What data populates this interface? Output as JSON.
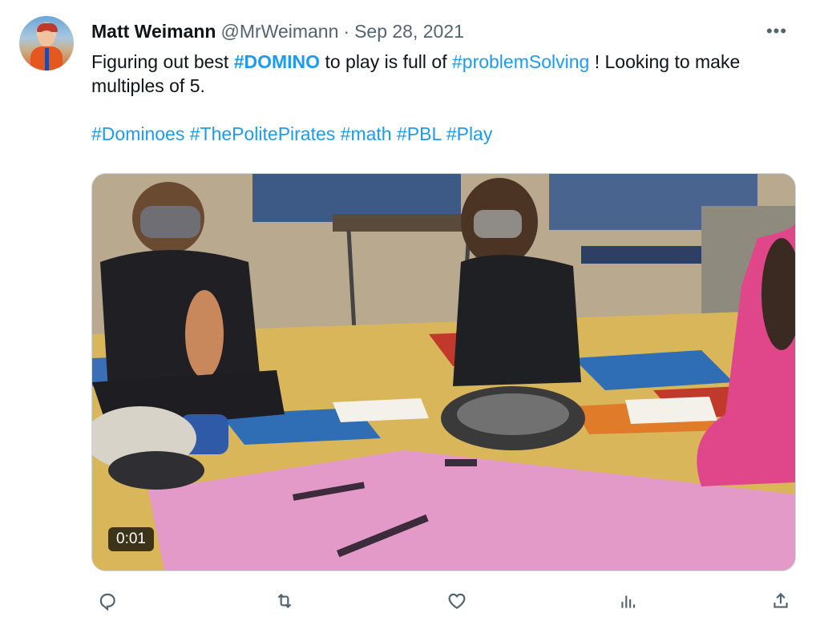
{
  "tweet": {
    "author_name": "Matt Weimann",
    "handle": "@MrWeimann",
    "separator": "·",
    "date": "Sep 28, 2021",
    "more_label": "•••",
    "text": {
      "part1": "Figuring out best ",
      "tag1": "#DOMINO",
      "part2": " to play is full of ",
      "tag2": "#problemSolving",
      "part3": " ! Looking to make multiples of 5.",
      "tags": [
        "#Dominoes",
        "#ThePolitePirates",
        "#math",
        "#PBL",
        "#Play"
      ]
    },
    "video": {
      "timestamp": "0:01"
    },
    "actions": [
      "reply-icon",
      "retweet-icon",
      "like-icon",
      "views-icon",
      "share-icon"
    ]
  },
  "colors": {
    "link": "#1d9bf0",
    "secondary_text": "#536471",
    "primary_text": "#0f1419"
  }
}
